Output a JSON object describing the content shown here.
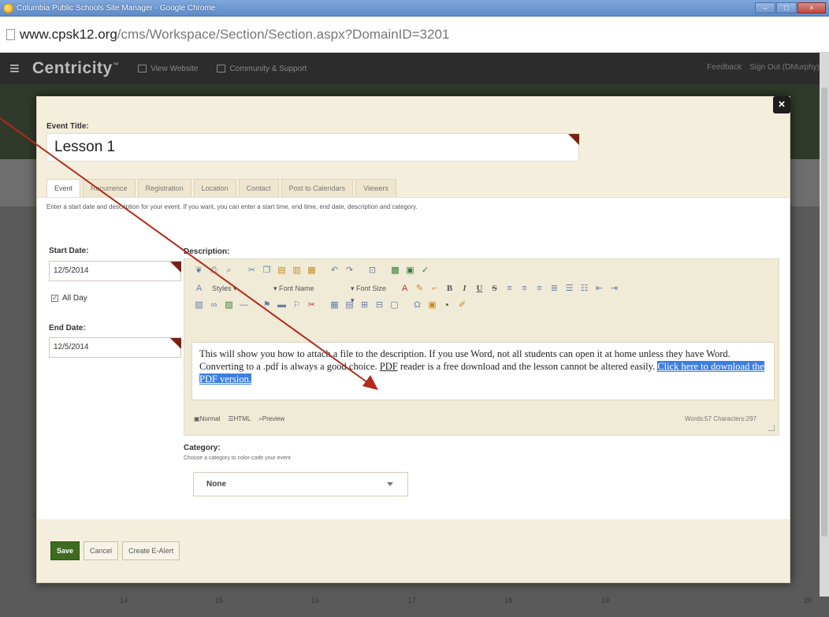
{
  "browser": {
    "window_title": "Columbia Public Schools Site Manager - Google Chrome",
    "url_host": "www.cpsk12.org",
    "url_path": "/cms/Workspace/Section/Section.aspx?DomainID=3201"
  },
  "site_header": {
    "brand": "Centricity",
    "brand_tm": "™",
    "nav": [
      "View Website",
      "Community & Support"
    ],
    "right": [
      "Feedback",
      "Sign Out (DMurphy)"
    ]
  },
  "modal": {
    "close_glyph": "×",
    "event_title_label": "Event Title:",
    "event_title_value": "Lesson 1",
    "tabs": [
      "Event",
      "Recurrence",
      "Registration",
      "Location",
      "Contact",
      "Post to Calendars",
      "Viewers"
    ],
    "tab_help": "Enter a start date and description for your event. If you want, you can enter a start time, end time, end date, description and category.",
    "start_date_label": "Start Date:",
    "start_date_value": "12/5/2014",
    "all_day_label": "All Day",
    "end_date_label": "End Date:",
    "end_date_value": "12/5/2014",
    "description_label": "Description:",
    "toolbar": {
      "styles": "Styles",
      "font_name": "Font Name",
      "font_size": "Font Size"
    },
    "description_text_1": "This will show you how to attach a file to the description.  If you use Word, not all students can open it at home unless they have Word.  Converting to a .pdf is always a good choice.  ",
    "description_pdf": "PDF",
    "description_text_2": " reader is a free download and the lesson cannot be altered easily.  ",
    "description_link": "Click here to download the PDF version.",
    "editor_modes": [
      "Normal",
      "HTML",
      "Preview"
    ],
    "word_count": "Words:57 Characters:297",
    "category_label": "Category:",
    "category_help": "Choose a category to color-code your event",
    "category_value": "None",
    "buttons": {
      "save": "Save",
      "cancel": "Cancel",
      "create_ealert": "Create E-Alert"
    }
  },
  "calendar_days": [
    "14",
    "15",
    "16",
    "17",
    "18",
    "19",
    "20"
  ],
  "colors": {
    "save_green": "#3e6b20",
    "modal_bg": "#f4eedc",
    "link_highlight": "#3d7fe0",
    "annotation_arrow": "#b32a1c"
  }
}
